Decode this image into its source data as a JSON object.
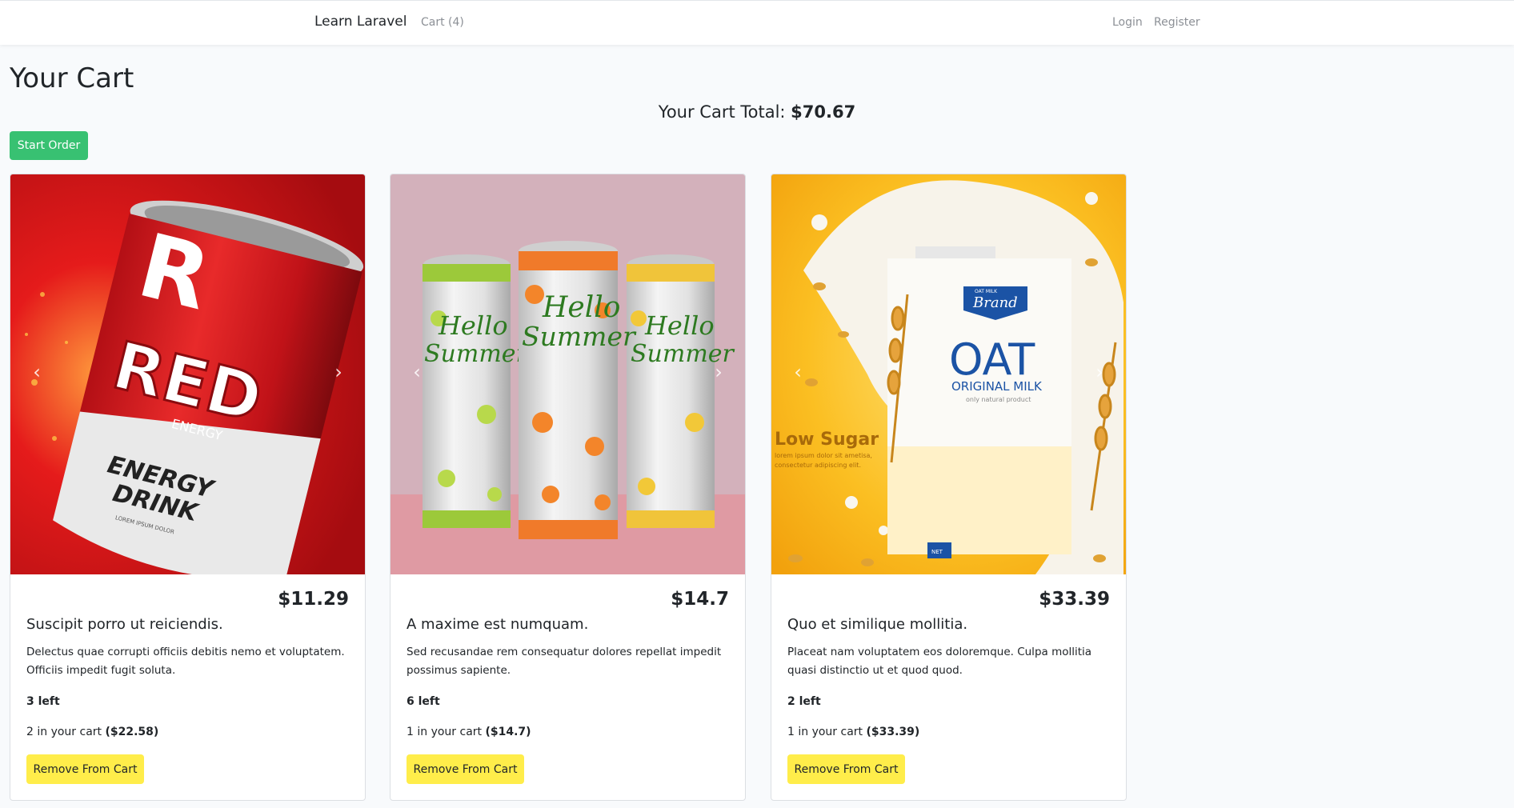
{
  "nav": {
    "brand": "Learn Laravel",
    "cart_link": "Cart (4)",
    "login": "Login",
    "register": "Register"
  },
  "page": {
    "title": "Your Cart",
    "total_label": "Your Cart Total:",
    "total_value": "$70.67",
    "start_order_label": "Start Order"
  },
  "products": [
    {
      "price": "$11.29",
      "title": "Suscipit porro ut reiciendis.",
      "description": "Delectus quae corrupti officiis debitis nemo et voluptatem. Officiis impedit fugit soluta.",
      "stock": "3 left",
      "in_cart_text": "2 in your cart",
      "in_cart_amount": "($22.58)",
      "remove_label": "Remove From Cart",
      "image_text": {
        "logo": "R",
        "brand": "RED",
        "sub": "ENERGY",
        "line1": "ENERGY",
        "line2": "DRINK",
        "small": "LOREM IPSUM DOLOR"
      }
    },
    {
      "price": "$14.7",
      "title": "A maxime est numquam.",
      "description": "Sed recusandae rem consequatur dolores repellat impedit possimus sapiente.",
      "stock": "6 left",
      "in_cart_text": "1 in your cart",
      "in_cart_amount": "($14.7)",
      "remove_label": "Remove From Cart",
      "image_text": {
        "line1": "Hello",
        "line2": "Summer"
      }
    },
    {
      "price": "$33.39",
      "title": "Quo et similique mollitia.",
      "description": "Placeat nam voluptatem eos doloremque. Culpa mollitia quasi distinctio ut et quod quod.",
      "stock": "2 left",
      "in_cart_text": "1 in your cart",
      "in_cart_amount": "($33.39)",
      "remove_label": "Remove From Cart",
      "image_text": {
        "badge_small": "OAT MILK",
        "badge": "Brand",
        "big": "OAT",
        "sub": "ORIGINAL MILK",
        "tiny": "only natural product",
        "low_sugar": "Low Sugar",
        "lorem1": "lorem ipsum dolor sit ametisa,",
        "lorem2": "consectetur adipiscing elit.",
        "label": "NET"
      }
    }
  ],
  "colors": {
    "start_order": "#38c172",
    "remove_button": "#ffed4a",
    "page_bg": "#f8fafc"
  },
  "icons": {
    "carousel_prev": "chevron-left-icon",
    "carousel_next": "chevron-right-icon"
  }
}
